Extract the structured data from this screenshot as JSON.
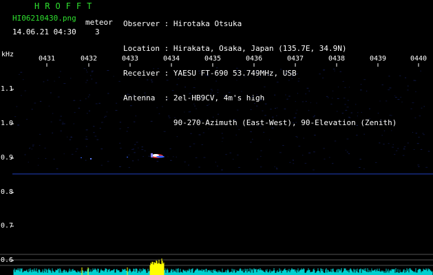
{
  "header": {
    "app_title": "HROFFT",
    "filename": "HI06210430.png",
    "datetime": "14.06.21 04:30",
    "meteor_label": "meteor",
    "meteor_count": "3",
    "observer": "Observer : Hirotaka Otsuka",
    "location": "Location : Hirakata, Osaka, Japan (135.7E, 34.9N)",
    "receiver": "Receiver : YAESU FT-690 53.749MHz, USB",
    "antenna": "Antenna  : 2el-HB9CV, 4m's high",
    "antenna_line2": "           90-270-Azimuth (East-West), 90-Elevation (Zenith)"
  },
  "axis": {
    "y_unit": "kHz",
    "time_labels": [
      "0431",
      "0432",
      "0433",
      "0434",
      "0435",
      "0436",
      "0437",
      "0438",
      "0439",
      "0440"
    ],
    "freq_labels": [
      "1.1",
      "1.0",
      "0.9",
      "0.8",
      "0.7",
      "0.6"
    ]
  },
  "colors": {
    "green_text": "#2fe02f",
    "carrier_line": "#1f3fbf",
    "level_trace": "#00d0d0",
    "level_peak": "#ffff00"
  }
}
